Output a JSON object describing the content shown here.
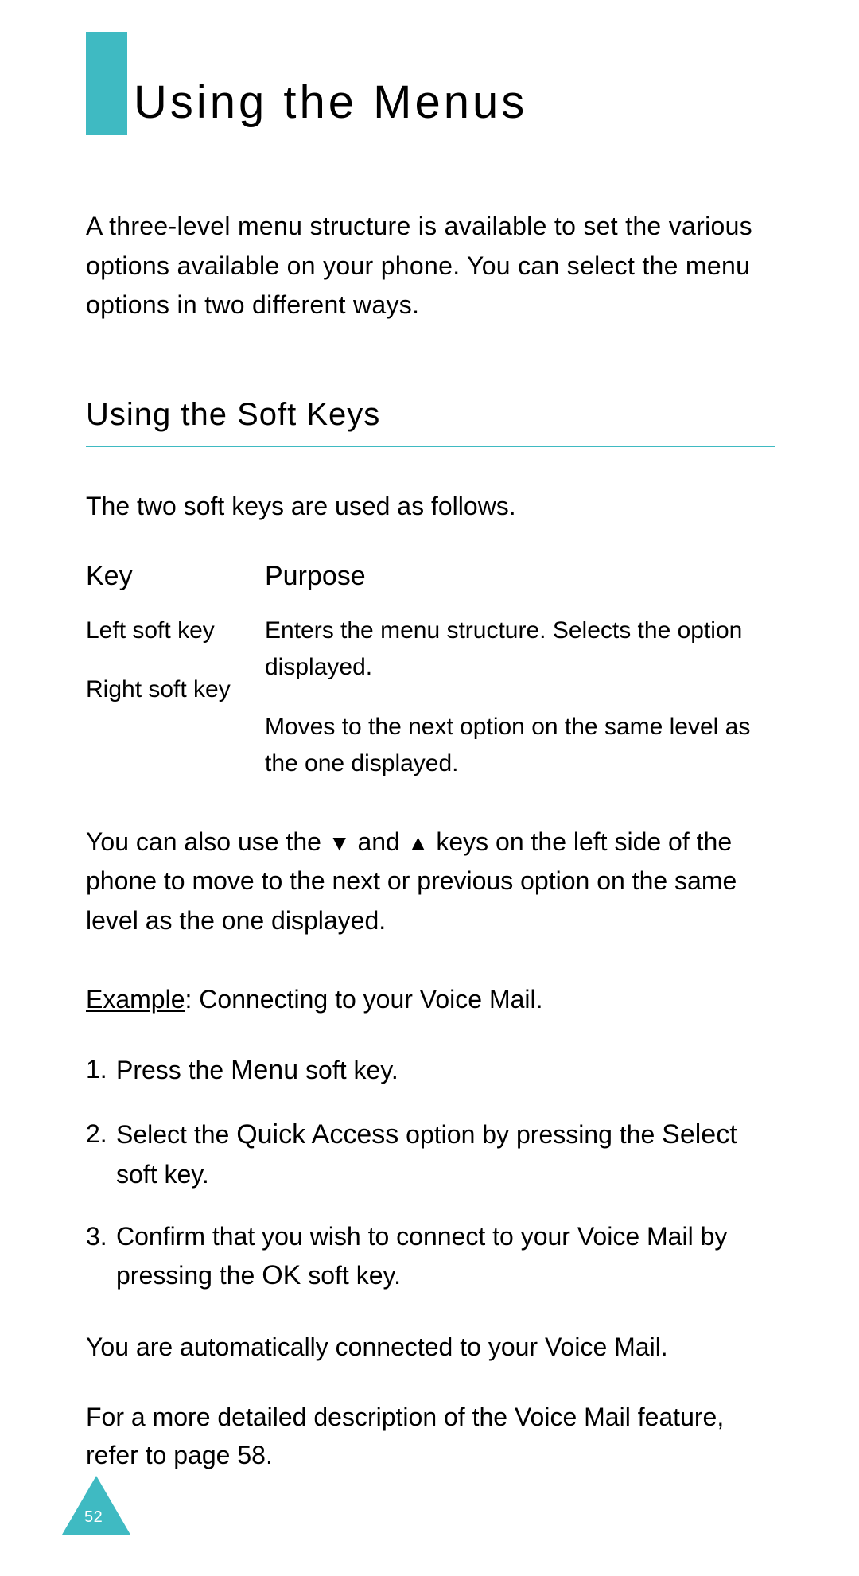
{
  "title": "Using the Menus",
  "intro": "A three-level menu structure is available to set the various options available on your phone. You can select the menu options in two different ways.",
  "section": {
    "title": "Using the Soft Keys",
    "lead": "The two soft keys are used as follows.",
    "headers": {
      "key": "Key",
      "purpose": "Purpose"
    },
    "rows": [
      {
        "key": "Left soft key",
        "purpose": "Enters the menu structure. Selects the option displayed."
      },
      {
        "key": "Right soft key",
        "purpose": "Moves to the next option on the same level as the one displayed."
      }
    ],
    "arrow_para_1": "You can also use the ",
    "arrow_down": "▼",
    "arrow_para_2": " and ",
    "arrow_up": "▲",
    "arrow_para_3": " keys on the left side of the phone to move to the next or previous option on the same level as the one displayed.",
    "example_label": "Example",
    "example_rest": ":  Connecting to your Voice Mail.",
    "steps": [
      {
        "prefix": "Press the ",
        "keyword": "Menu",
        "suffix": " soft key."
      },
      {
        "prefix": "Select the ",
        "keyword": "Quick Access",
        "suffix": " option by pressing the ",
        "keyword2": "Select",
        "suffix2": " soft key."
      },
      {
        "prefix": "Confirm that you wish to connect to your Voice Mail by pressing the ",
        "keyword": "OK",
        "suffix": " soft key."
      }
    ],
    "closing1": "You are automatically connected to your Voice Mail.",
    "closing2": "For a more detailed description of the Voice Mail feature, refer to page 58."
  },
  "page_number": "52",
  "colors": {
    "accent": "#3fbac2"
  }
}
